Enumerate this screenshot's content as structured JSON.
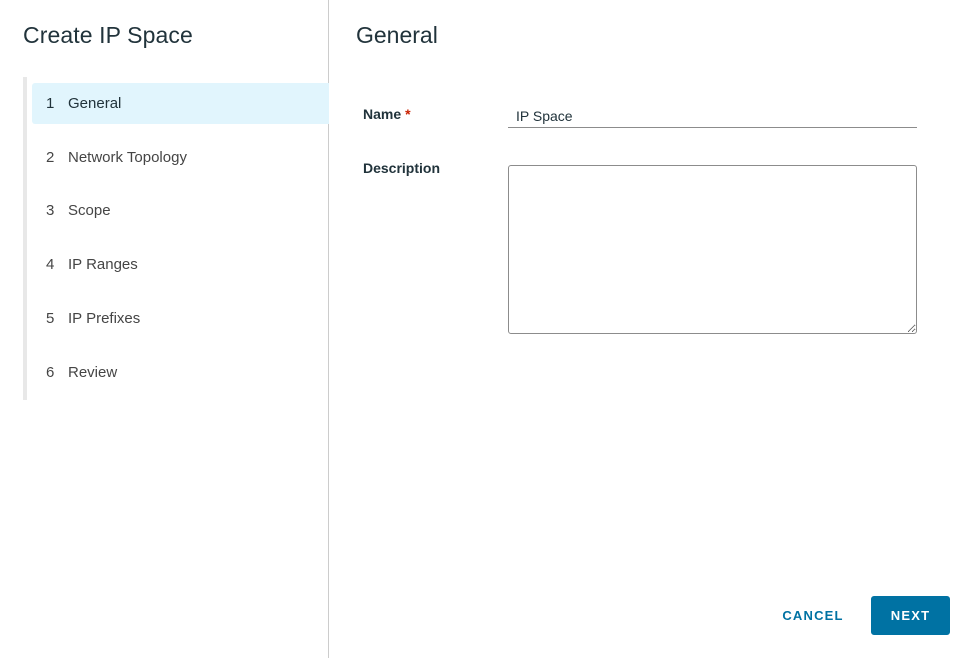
{
  "wizard": {
    "title": "Create IP Space",
    "steps": [
      {
        "number": "1",
        "label": "General",
        "active": true
      },
      {
        "number": "2",
        "label": "Network Topology",
        "active": false
      },
      {
        "number": "3",
        "label": "Scope",
        "active": false
      },
      {
        "number": "4",
        "label": "IP Ranges",
        "active": false
      },
      {
        "number": "5",
        "label": "IP Prefixes",
        "active": false
      },
      {
        "number": "6",
        "label": "Review",
        "active": false
      }
    ]
  },
  "form": {
    "section_title": "General",
    "name": {
      "label": "Name",
      "required_marker": "*",
      "value": "IP Space"
    },
    "description": {
      "label": "Description",
      "value": ""
    }
  },
  "footer": {
    "cancel_label": "CANCEL",
    "next_label": "NEXT"
  },
  "colors": {
    "accent": "#0072a3",
    "active_step_bg": "#e1f5fd",
    "required": "#c92100"
  }
}
